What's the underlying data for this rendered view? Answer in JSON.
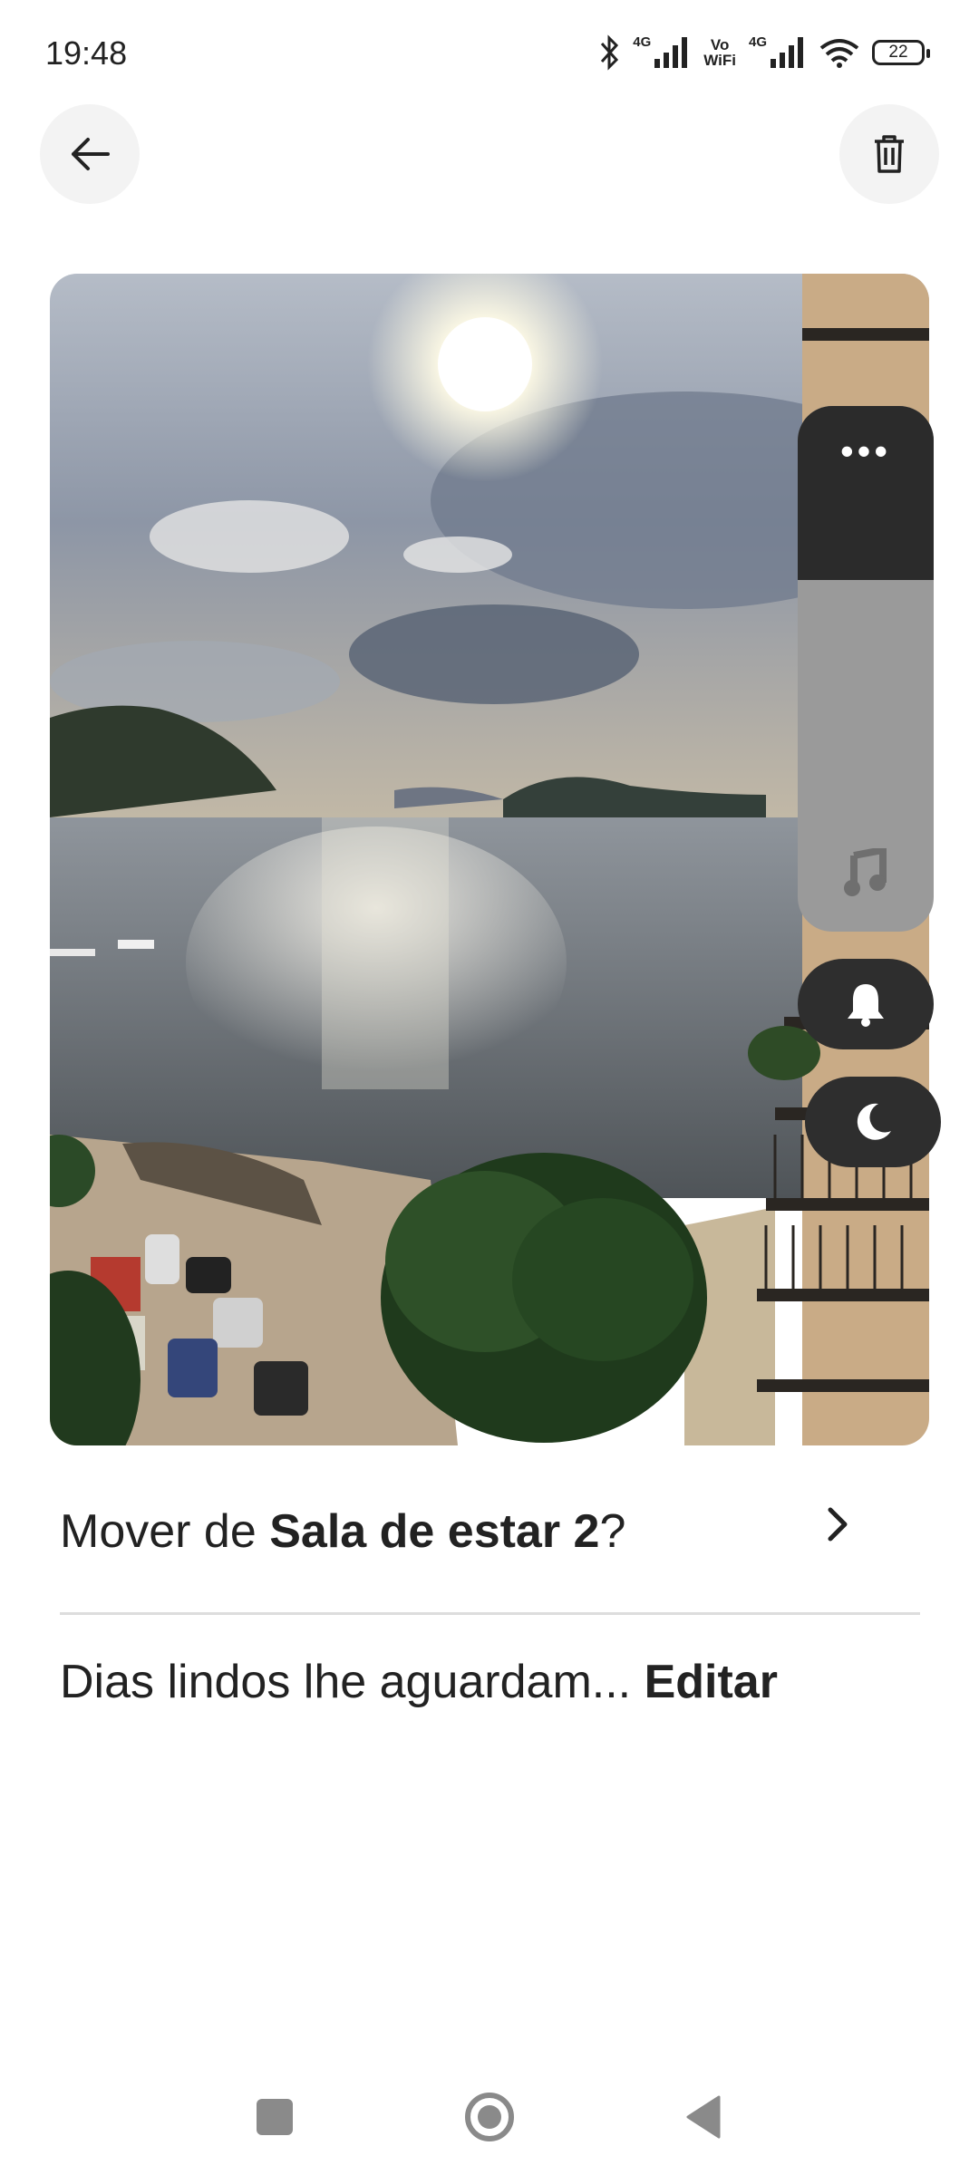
{
  "status_bar": {
    "time": "19:48",
    "sim1_label": "4G",
    "vowifi_top": "Vo",
    "vowifi_bottom": "WiFi",
    "sim2_label": "4G",
    "battery": "22"
  },
  "header": {
    "back_icon": "arrow-left-icon",
    "delete_icon": "trash-icon"
  },
  "volume_panel": {
    "more_label": "•••",
    "music_icon": "music-note-icon",
    "bell_icon": "bell-icon",
    "moon_icon": "moon-icon",
    "level": 0.33
  },
  "move_row": {
    "prefix": "Mover de ",
    "room": "Sala de estar 2",
    "suffix": "?"
  },
  "caption": {
    "text": "Dias lindos lhe aguardam... ",
    "edit_label": "Editar"
  },
  "colors": {
    "background": "#ffffff",
    "text": "#222222",
    "button_bg": "#f3f3f3",
    "panel_dark": "#2b2b2b",
    "panel_light": "#9a9a9a"
  }
}
